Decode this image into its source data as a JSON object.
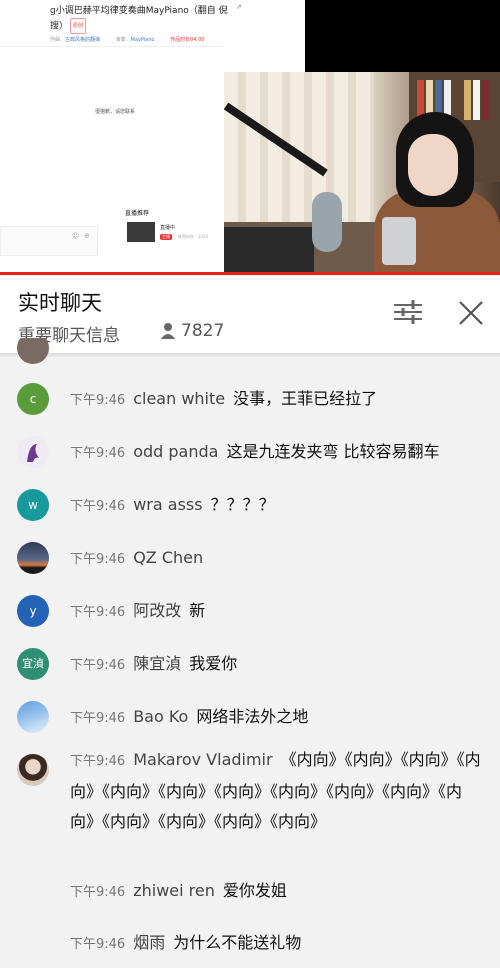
{
  "shared_screen": {
    "title": "g小调巴赫平均律变奏曲MayPiano（翻自 倪搜）",
    "badge": "原创",
    "corner": "↗",
    "meta": [
      {
        "label": "作曲：",
        "value": "古典风格的翻弹"
      },
      {
        "label": "演奏：",
        "value": "MayPiano"
      },
      {
        "label": "",
        "value": "作品时长04:00"
      }
    ],
    "message": "很抱歉，请您联系",
    "input_icons": [
      "☺",
      "⊕"
    ],
    "recommend_title": "直播推荐",
    "card_name": "直播中",
    "card_tag": "主播",
    "card_sub": "推荐给你 · 1024",
    "tiny": "·"
  },
  "chat_header": {
    "title": "实时聊天",
    "subtitle": "重要聊天信息",
    "viewer_count": "7827",
    "icons": [
      "person-icon",
      "filter-sliders-icon",
      "close-icon"
    ]
  },
  "messages": [
    {
      "time": "",
      "author": "",
      "text": "",
      "avatar": {
        "type": "photo",
        "color": "#7a6a64"
      }
    },
    {
      "time": "下午9:46",
      "author": "clean white",
      "text": "没事，王菲已经拉了",
      "avatar": {
        "type": "letter",
        "letter": "c",
        "color": "#5a9b3c"
      }
    },
    {
      "time": "下午9:46",
      "author": "odd panda",
      "text": "这是九连发夹弯 比较容易翻车",
      "avatar": {
        "type": "photo",
        "color": "#6b3a8c"
      }
    },
    {
      "time": "下午9:46",
      "author": "wra asss",
      "text": "？？？？",
      "avatar": {
        "type": "letter",
        "letter": "w",
        "color": "#18999c"
      }
    },
    {
      "time": "下午9:46",
      "author": "QZ Chen",
      "text": "",
      "avatar": {
        "type": "photo",
        "color": "#3b4a63"
      }
    },
    {
      "time": "下午9:46",
      "author": "阿改改",
      "text": "新",
      "avatar": {
        "type": "letter",
        "letter": "y",
        "color": "#2462b5"
      }
    },
    {
      "time": "下午9:46",
      "author": "陳宜湞",
      "text": "我爱你",
      "avatar": {
        "type": "letter",
        "letter": "宜湞",
        "color": "#2e8f74"
      }
    },
    {
      "time": "下午9:46",
      "author": "Bao Ko",
      "text": "网络非法外之地",
      "avatar": {
        "type": "photo",
        "color": "#77aee0"
      }
    },
    {
      "time": "下午9:46",
      "author": "Makarov Vladimir",
      "text": "《内向》《内向》《内向》《内向》《内向》《内向》《内向》《内向》《内向》《内向》《内向》《内向》《内向》《内向》《内向》",
      "avatar": {
        "type": "photo",
        "color": "#cdb8a8"
      }
    },
    {
      "time": "下午9:46",
      "author": "zhiwei ren",
      "text": "爱你发姐",
      "avatar": {
        "type": "none"
      }
    },
    {
      "time": "下午9:46",
      "author": "烟雨",
      "text": "为什么不能送礼物",
      "avatar": {
        "type": "none"
      }
    }
  ]
}
